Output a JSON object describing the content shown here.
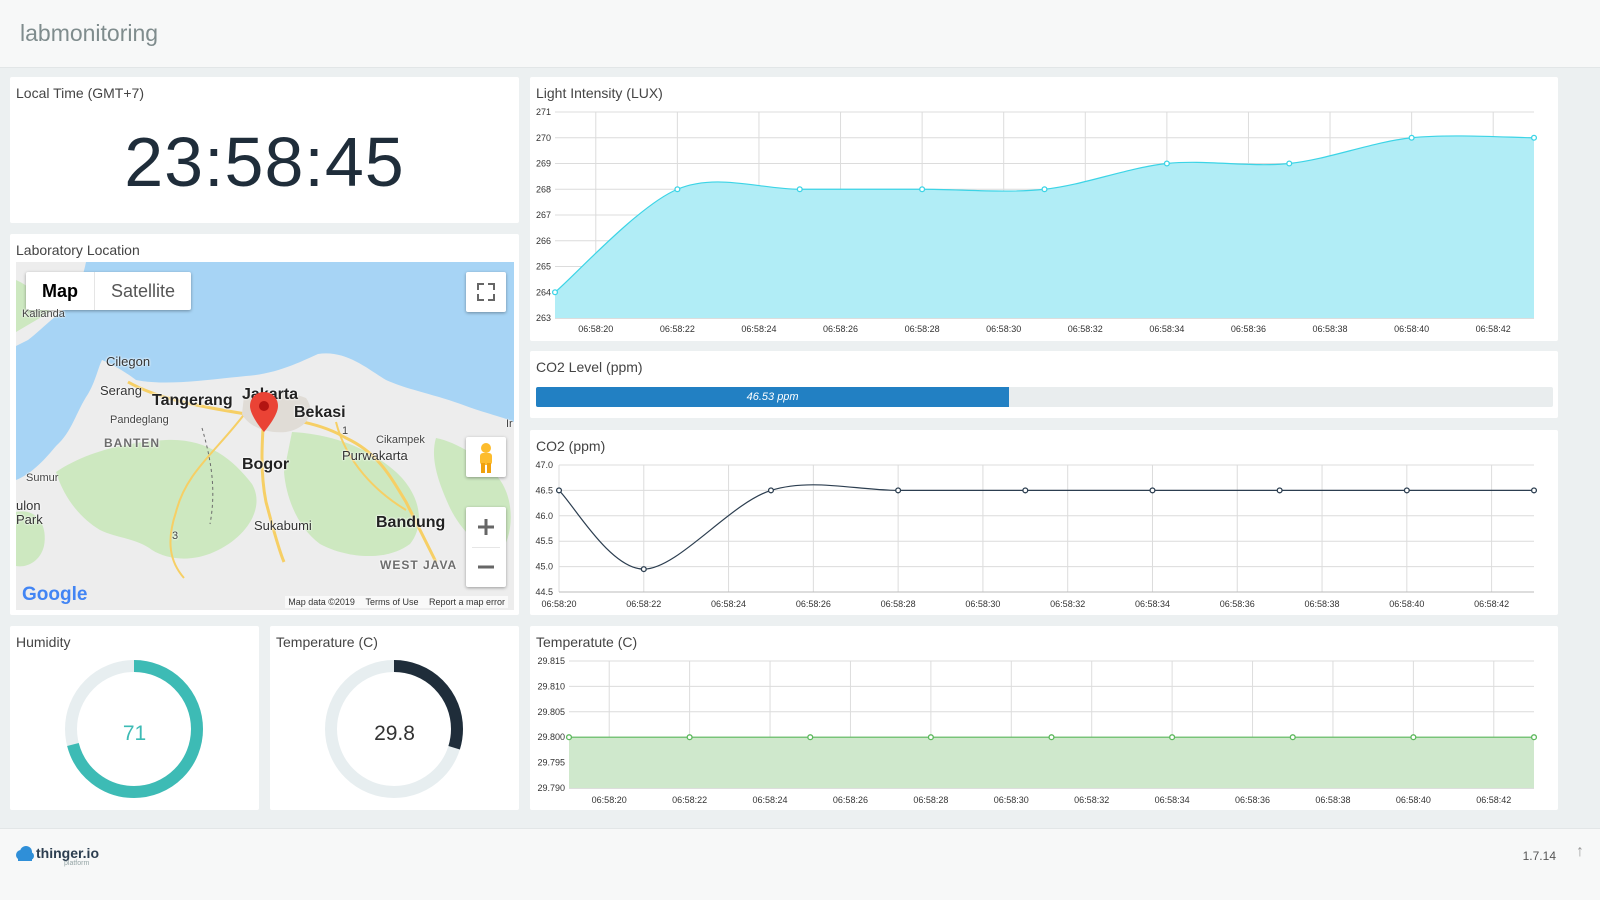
{
  "header": {
    "title": "labmonitoring"
  },
  "clock_widget": {
    "title": "Local Time (GMT+7)",
    "time": "23:58:45"
  },
  "map_widget": {
    "title": "Laboratory Location",
    "type_controls": {
      "map_label": "Map",
      "satellite_label": "Satellite"
    },
    "labels": {
      "kalianda": "Kalianda",
      "cilegon": "Cilegon",
      "serang": "Serang",
      "tangerang": "Tangerang",
      "jakarta": "Jakarta",
      "bekasi": "Bekasi",
      "pandeglang": "Pandeglang",
      "banten": "BANTEN",
      "cikampek": "Cikampek",
      "purwakarta": "Purwakarta",
      "bogor": "Bogor",
      "sumur": "Sumur",
      "ulon": "ulon",
      "park": "Park",
      "sukabumi": "Sukabumi",
      "bandung": "Bandung",
      "west_java": "WEST JAVA",
      "road_1": "1",
      "road_3": "3",
      "ir": "Ir"
    },
    "footer": {
      "map_data": "Map data ©2019",
      "terms": "Terms of Use",
      "report": "Report a map error"
    },
    "google": "Google",
    "icons": [
      "fullscreen-icon",
      "pegman-icon",
      "zoom-in-icon",
      "zoom-out-icon",
      "map-pin-icon"
    ],
    "colors": {
      "water": "#a7d4f5",
      "land": "#ededed",
      "forest": "#cde8c0",
      "pin": "#ea4335"
    }
  },
  "humidity_widget": {
    "title": "Humidity",
    "value": "71",
    "fraction": 0.71,
    "color": "#3dbbb5"
  },
  "temperature_widget": {
    "title": "Temperature (C)",
    "value": "29.8",
    "fraction": 0.298,
    "color": "#1f2d3a"
  },
  "co2_level_widget": {
    "title": "CO2 Level (ppm)",
    "label": "46.53 ppm",
    "percent": 46.53,
    "color": "#2280c3"
  },
  "chart_data": [
    {
      "type": "area",
      "title": "Light Intensity (LUX)",
      "x": [
        "06:58:19",
        "06:58:22",
        "06:58:25",
        "06:58:28",
        "06:58:31",
        "06:58:34",
        "06:58:37",
        "06:58:40",
        "06:58:43"
      ],
      "values": [
        264,
        268,
        268,
        268,
        268,
        269,
        269,
        270,
        270
      ],
      "xticks": [
        "06:58:20",
        "06:58:22",
        "06:58:24",
        "06:58:26",
        "06:58:28",
        "06:58:30",
        "06:58:32",
        "06:58:34",
        "06:58:36",
        "06:58:38",
        "06:58:40",
        "06:58:42"
      ],
      "yticks": [
        "263",
        "264",
        "265",
        "266",
        "267",
        "268",
        "269",
        "270",
        "271"
      ],
      "ylim": [
        263,
        271
      ],
      "grid": true,
      "color": "#3cd4e6",
      "fill": "#b1edf6"
    },
    {
      "type": "line",
      "title": "CO2 (ppm)",
      "x": [
        "06:58:20",
        "06:58:22",
        "06:58:25",
        "06:58:28",
        "06:58:31",
        "06:58:34",
        "06:58:37",
        "06:58:40",
        "06:58:43"
      ],
      "values": [
        46.5,
        44.95,
        46.5,
        46.5,
        46.5,
        46.5,
        46.5,
        46.5,
        46.5
      ],
      "xticks": [
        "06:58:20",
        "06:58:22",
        "06:58:24",
        "06:58:26",
        "06:58:28",
        "06:58:30",
        "06:58:32",
        "06:58:34",
        "06:58:36",
        "06:58:38",
        "06:58:40",
        "06:58:42"
      ],
      "yticks": [
        "44.5",
        "45.0",
        "45.5",
        "46.0",
        "46.5",
        "47.0"
      ],
      "ylim": [
        44.5,
        47.0
      ],
      "grid": true,
      "color": "#2c3e50"
    },
    {
      "type": "area",
      "title": "Temperatute (C)",
      "x": [
        "06:58:19",
        "06:58:22",
        "06:58:25",
        "06:58:28",
        "06:58:31",
        "06:58:34",
        "06:58:37",
        "06:58:40",
        "06:58:43"
      ],
      "values": [
        29.8,
        29.8,
        29.8,
        29.8,
        29.8,
        29.8,
        29.8,
        29.8,
        29.8
      ],
      "xticks": [
        "06:58:20",
        "06:58:22",
        "06:58:24",
        "06:58:26",
        "06:58:28",
        "06:58:30",
        "06:58:32",
        "06:58:34",
        "06:58:36",
        "06:58:38",
        "06:58:40",
        "06:58:42"
      ],
      "yticks": [
        "29.790",
        "29.795",
        "29.800",
        "29.805",
        "29.810",
        "29.815"
      ],
      "ylim": [
        29.79,
        29.815
      ],
      "grid": true,
      "color": "#5cb85c",
      "fill": "#cfe8cc"
    }
  ],
  "footer": {
    "brand": "thinger.io",
    "brand_sub": "platform",
    "version": "1.7.14",
    "scroll_icon": "arrow-up-icon"
  }
}
